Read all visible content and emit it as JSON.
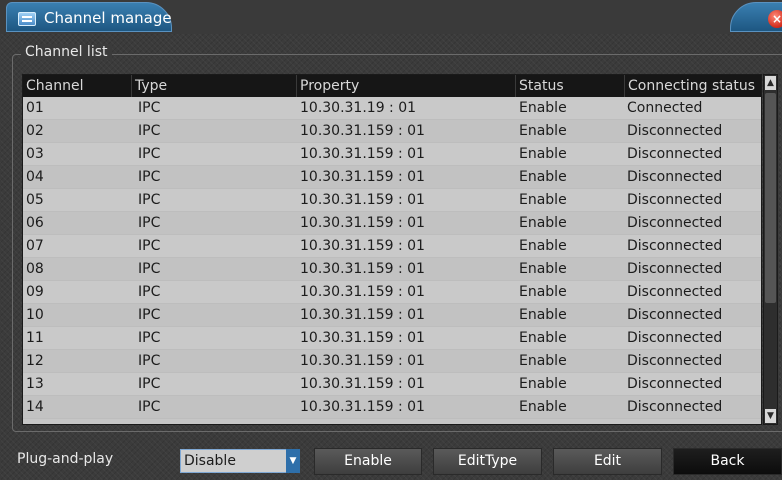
{
  "window": {
    "title": "Channel manage",
    "close_label": "×"
  },
  "group": {
    "label": "Channel list"
  },
  "table": {
    "columns": [
      "Channel",
      "Type",
      "Property",
      "Status",
      "Connecting status"
    ],
    "rows": [
      [
        "01",
        "IPC",
        "10.30.31.19 : 01",
        "Enable",
        "Connected"
      ],
      [
        "02",
        "IPC",
        "10.30.31.159 : 01",
        "Enable",
        "Disconnected"
      ],
      [
        "03",
        "IPC",
        "10.30.31.159 : 01",
        "Enable",
        "Disconnected"
      ],
      [
        "04",
        "IPC",
        "10.30.31.159 : 01",
        "Enable",
        "Disconnected"
      ],
      [
        "05",
        "IPC",
        "10.30.31.159 : 01",
        "Enable",
        "Disconnected"
      ],
      [
        "06",
        "IPC",
        "10.30.31.159 : 01",
        "Enable",
        "Disconnected"
      ],
      [
        "07",
        "IPC",
        "10.30.31.159 : 01",
        "Enable",
        "Disconnected"
      ],
      [
        "08",
        "IPC",
        "10.30.31.159 : 01",
        "Enable",
        "Disconnected"
      ],
      [
        "09",
        "IPC",
        "10.30.31.159 : 01",
        "Enable",
        "Disconnected"
      ],
      [
        "10",
        "IPC",
        "10.30.31.159 : 01",
        "Enable",
        "Disconnected"
      ],
      [
        "11",
        "IPC",
        "10.30.31.159 : 01",
        "Enable",
        "Disconnected"
      ],
      [
        "12",
        "IPC",
        "10.30.31.159 : 01",
        "Enable",
        "Disconnected"
      ],
      [
        "13",
        "IPC",
        "10.30.31.159 : 01",
        "Enable",
        "Disconnected"
      ],
      [
        "14",
        "IPC",
        "10.30.31.159 : 01",
        "Enable",
        "Disconnected"
      ]
    ]
  },
  "bottom": {
    "plug_label": "Plug-and-play",
    "plug_value": "Disable",
    "buttons": {
      "enable": "Enable",
      "edit_type": "EditType",
      "edit": "Edit",
      "back": "Back"
    }
  },
  "colors": {
    "accent": "#2e6faa",
    "title_tab": "#3a7fb1",
    "background": "#3b3b3b",
    "row": "#c6c6c6"
  },
  "icons": {
    "app": "channel-app-icon",
    "close": "close-icon",
    "scroll_up": "scroll-up-arrow-icon",
    "scroll_down": "scroll-down-arrow-icon",
    "dropdown": "chevron-down-icon"
  }
}
